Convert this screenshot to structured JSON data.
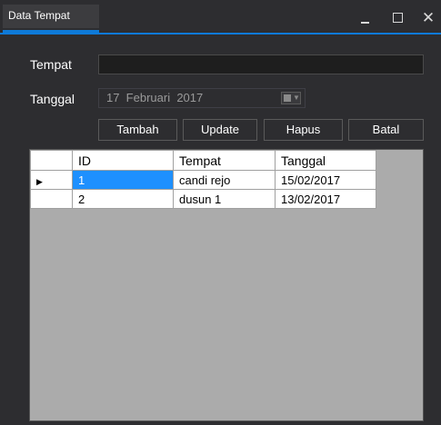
{
  "window": {
    "tab_title": "Data Tempat",
    "controls": {
      "minimize": "_",
      "maximize": "□",
      "close": "✕"
    }
  },
  "form": {
    "tempat_label": "Tempat",
    "tempat_value": "",
    "tanggal_label": "Tanggal",
    "date_value": "17  Februari  2017"
  },
  "buttons": {
    "tambah": "Tambah",
    "update": "Update",
    "hapus": "Hapus",
    "batal": "Batal"
  },
  "grid": {
    "columns": [
      "ID",
      "Tempat",
      "Tanggal"
    ],
    "rows": [
      {
        "id": "1",
        "tempat": "candi rejo",
        "tanggal": "15/02/2017",
        "current": true
      },
      {
        "id": "2",
        "tempat": "dusun 1",
        "tanggal": "13/02/2017",
        "current": false
      }
    ],
    "current_row_marker": "▶"
  },
  "colors": {
    "accent": "#0e7ad8",
    "background": "#2d2d30",
    "grid_background": "#ababab",
    "selection": "#1e90ff"
  }
}
